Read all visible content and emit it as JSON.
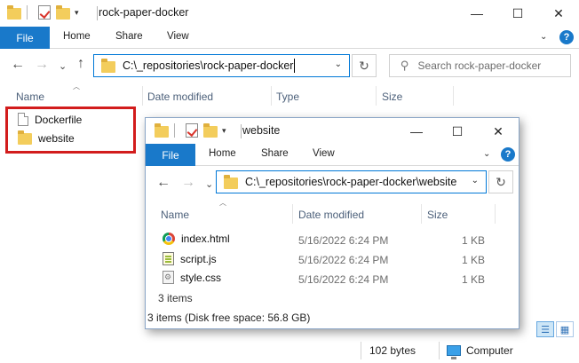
{
  "outer": {
    "title": "rock-paper-docker",
    "ribbon_tabs": [
      "File",
      "Home",
      "Share",
      "View"
    ],
    "address": "C:\\_repositories\\rock-paper-docker",
    "search_placeholder": "Search rock-paper-docker",
    "columns": [
      "Name",
      "Date modified",
      "Type",
      "Size"
    ],
    "items": [
      {
        "name": "Dockerfile",
        "icon": "file-icon"
      },
      {
        "name": "website",
        "icon": "folder-icon"
      }
    ],
    "status": {
      "size": "102 bytes",
      "zone": "Computer"
    }
  },
  "inner": {
    "title": "website",
    "ribbon_tabs": [
      "File",
      "Home",
      "Share",
      "View"
    ],
    "address": "C:\\_repositories\\rock-paper-docker\\website",
    "columns": [
      "Name",
      "Date modified",
      "Size"
    ],
    "items": [
      {
        "name": "index.html",
        "date": "5/16/2022 6:24 PM",
        "size": "1 KB",
        "icon": "chrome-html-icon"
      },
      {
        "name": "script.js",
        "date": "5/16/2022 6:24 PM",
        "size": "1 KB",
        "icon": "js-file-icon"
      },
      {
        "name": "style.css",
        "date": "5/16/2022 6:24 PM",
        "size": "1 KB",
        "icon": "css-file-icon"
      }
    ],
    "items_count": "3 items",
    "status": "3 items (Disk free space: 56.8 GB)"
  },
  "glyphs": {
    "minimize": "—",
    "maximize": "☐",
    "close": "✕",
    "back": "←",
    "forward": "→",
    "down": "⌄",
    "up": "↑",
    "refresh": "↻",
    "search": "⚲",
    "chevron_up": "︿",
    "chevron_down": "⌄",
    "qat_dropdown": "▾",
    "sort_up": "︿",
    "help": "?",
    "details_view": "☰",
    "tiles_view": "▦"
  },
  "colors": {
    "accent": "#1979ca",
    "highlight_box": "#d21c1c",
    "address_border": "#0078d7"
  }
}
